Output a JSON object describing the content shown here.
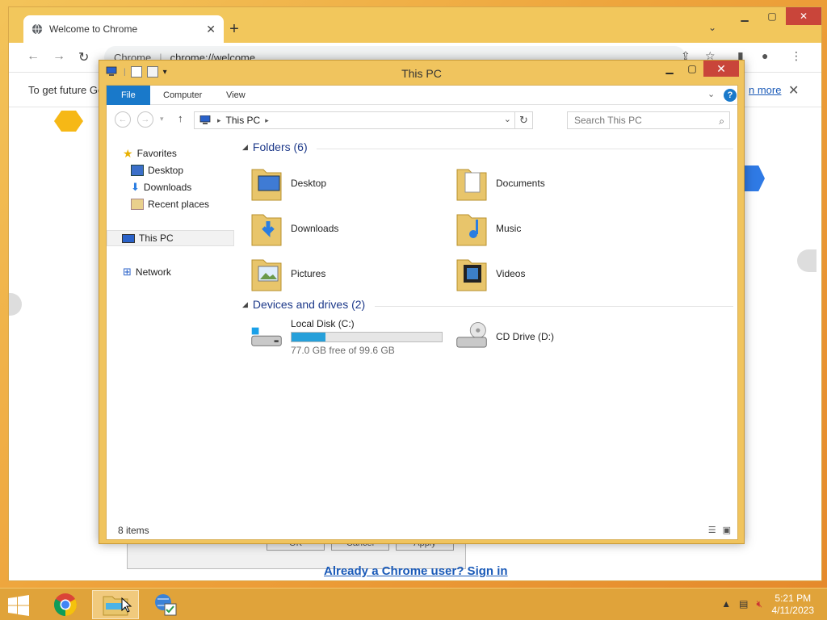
{
  "chrome": {
    "tab_title": "Welcome to Chrome",
    "omnibox_label": "Chrome",
    "url": "chrome://welcome",
    "infobar_message": "To get future Go",
    "infobar_link": "n more",
    "signin_link": "Already a Chrome user? Sign in",
    "dialog_buttons": [
      "OK",
      "Cancel",
      "Apply"
    ]
  },
  "explorer": {
    "title": "This PC",
    "ribbon_tabs": [
      "File",
      "Computer",
      "View"
    ],
    "address": "This PC",
    "search_placeholder": "Search This PC",
    "nav": {
      "favorites": "Favorites",
      "favorites_items": [
        "Desktop",
        "Downloads",
        "Recent places"
      ],
      "this_pc": "This PC",
      "network": "Network"
    },
    "folders_header": "Folders (6)",
    "folders": [
      "Desktop",
      "Documents",
      "Downloads",
      "Music",
      "Pictures",
      "Videos"
    ],
    "devices_header": "Devices and drives (2)",
    "drives": [
      {
        "name": "Local Disk (C:)",
        "free_text": "77.0 GB free of 99.6 GB",
        "used_fraction": 0.227
      },
      {
        "name": "CD Drive (D:)"
      }
    ],
    "status_count": "8 items"
  },
  "taskbar": {
    "time": "5:21 PM",
    "date": "4/11/2023"
  },
  "colors": {
    "accent_blue": "#1979ca",
    "drive_bar": "#26a0da",
    "close_red": "#c9453a",
    "window_frame": "#f0c45e"
  }
}
